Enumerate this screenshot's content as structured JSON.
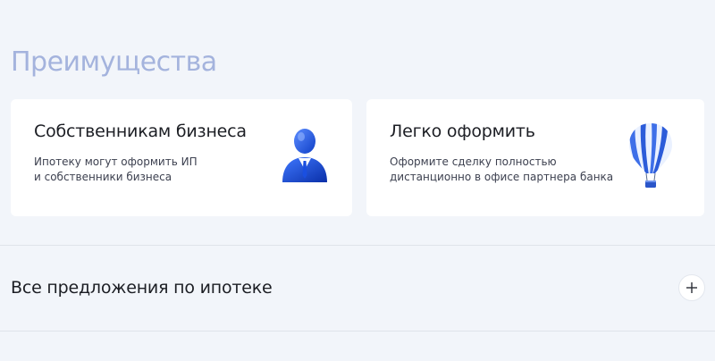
{
  "section": {
    "title": "Преимущества"
  },
  "cards": [
    {
      "title": "Собственникам бизнеса",
      "description_lines": [
        "Ипотеку могут оформить ИП",
        "и собственники бизнеса"
      ],
      "icon": "business-owner-icon"
    },
    {
      "title": "Легко оформить",
      "description_lines": [
        "Оформите сделку полностью",
        "дистанционно в офисе партнера банка"
      ],
      "icon": "hot-air-balloon-icon"
    }
  ],
  "accordion": {
    "label": "Все предложения по ипотеке",
    "toggle_icon": "plus-icon",
    "expanded": false
  },
  "colors": {
    "background": "#f2f5fa",
    "section_title": "#a4b3dd",
    "card_background": "#ffffff",
    "accent_blue": "#1f5fe8",
    "text_primary": "#1c1e24",
    "text_secondary": "#3d4150"
  }
}
